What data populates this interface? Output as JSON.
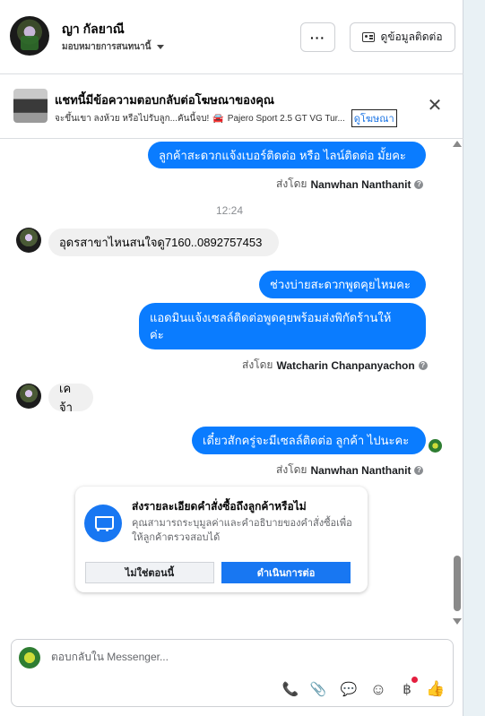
{
  "header": {
    "contact_name": "ญา กัลยาณี",
    "assign_label": "มอบหมายการสนทนานี้",
    "more_label": "···",
    "contact_info_label": "ดูข้อมูลติดต่อ"
  },
  "ad_banner": {
    "title": "แชทนี้มีข้อความตอบกลับต่อโฆษณาของคุณ",
    "subtitle": "จะขึ้นเขา ลงห้วย หรือไปรับลูก...คันนี้จบ!",
    "car_emoji": "🚘",
    "ad_name": "Pajero Sport 2.5 GT VG Tur...",
    "link_label": "ดูโฆษณา",
    "close_label": "✕"
  },
  "messages": {
    "m1": "ลูกค้าสะดวกแจ้งเบอร์ติดต่อ หรือ ไลน์ติดต่อ มั้ยคะ",
    "m1_sentby_prefix": "ส่งโดย",
    "m1_sentby_name": "Nanwhan Nanthanit",
    "time": "12:24",
    "m2": "อุดรสาขาไหนสนใจดู7160..0892757453",
    "m3": "ช่วงบ่ายสะดวกพูดคุยไหมคะ",
    "m4_line1": "แอดมินแจ้งเซลล์ติดต่อพูดคุยพร้อมส่งพิกัดร้านให้",
    "m4_line2": "ค่ะ",
    "m4_sentby_prefix": "ส่งโดย",
    "m4_sentby_name": "Watcharin Chanpanyachon",
    "m5": "เคจ้า",
    "m6": "เดี๋ยวสักครู่จะมีเซลล์ติดต่อ ลูกค้า ไปนะคะ",
    "m6_sentby_prefix": "ส่งโดย",
    "m6_sentby_name": "Nanwhan Nanthanit",
    "info_glyph": "?"
  },
  "order_card": {
    "title": "ส่งรายละเอียดคำสั่งซื้อถึงลูกค้าหรือไม่",
    "description": "คุณสามารถระบุมูลค่าและคำอธิบายของคำสั่งซื้อเพื่อให้ลูกค้าตรวจสอบได้",
    "decline_label": "ไม่ใช่ตอนนี้",
    "continue_label": "ดำเนินการต่อ"
  },
  "composer": {
    "placeholder": "ตอบกลับใน Messenger...",
    "tools": {
      "call": "📞",
      "attach": "📎",
      "saved_reply": "💬",
      "emoji": "☺",
      "currency": "฿",
      "like": "👍"
    }
  }
}
